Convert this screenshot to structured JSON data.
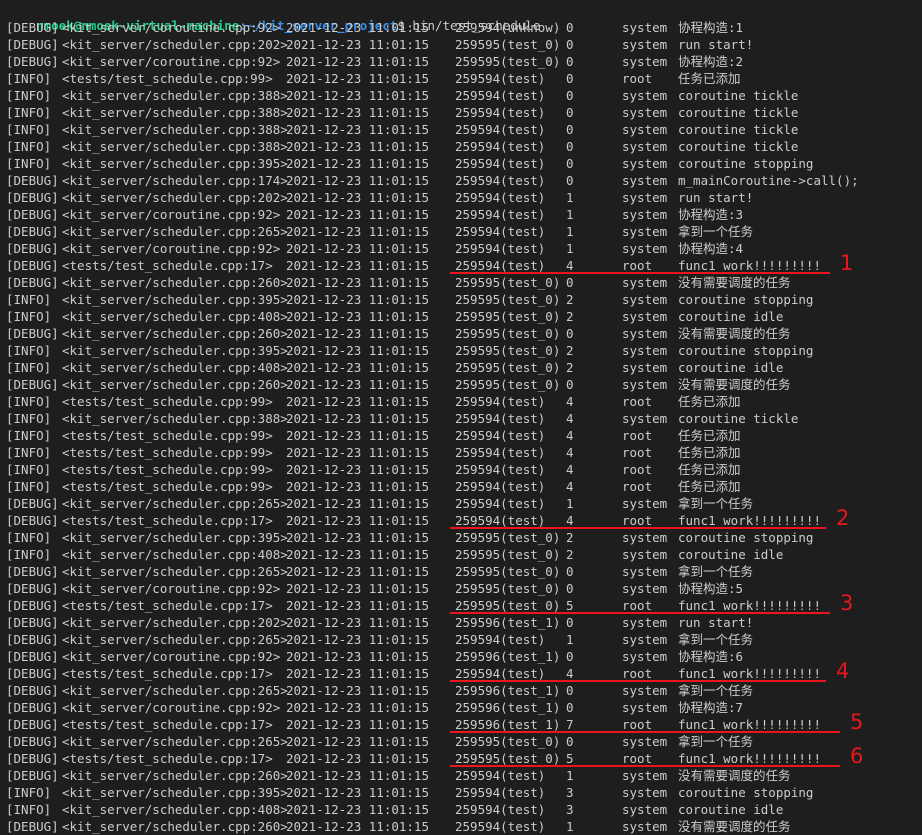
{
  "prompt": {
    "user_host": "nmoek@nmoek-virtual-machine",
    "path": ":~/kit_server_project",
    "command": "$ bin/test_schedule"
  },
  "colors": {
    "background": "#1e1e1e",
    "text": "#cccccc",
    "prompt_user": "#23d18b",
    "prompt_path": "#3b8eea",
    "annotation": "#e8171e"
  },
  "rows": [
    {
      "level": "[DEBUG]",
      "src": "<kit_server/coroutine.cpp:92>",
      "time": "2021-12-23 11:01:15",
      "tid": "259594(unknow)",
      "fib": "0",
      "logger": "system",
      "msg": "协程构造:1"
    },
    {
      "level": "[DEBUG]",
      "src": "<kit_server/scheduler.cpp:202>",
      "time": "2021-12-23 11:01:15",
      "tid": "259595(test_0)",
      "fib": "0",
      "logger": "system",
      "msg": "run start!"
    },
    {
      "level": "[DEBUG]",
      "src": "<kit_server/coroutine.cpp:92>",
      "time": "2021-12-23 11:01:15",
      "tid": "259595(test_0)",
      "fib": "0",
      "logger": "system",
      "msg": "协程构造:2"
    },
    {
      "level": "[INFO]",
      "src": "<tests/test_schedule.cpp:99>",
      "time": "2021-12-23 11:01:15",
      "tid": "259594(test)",
      "fib": "0",
      "logger": "root",
      "msg": "任务已添加"
    },
    {
      "level": "[INFO]",
      "src": "<kit_server/scheduler.cpp:388>",
      "time": "2021-12-23 11:01:15",
      "tid": "259594(test)",
      "fib": "0",
      "logger": "system",
      "msg": "coroutine tickle"
    },
    {
      "level": "[INFO]",
      "src": "<kit_server/scheduler.cpp:388>",
      "time": "2021-12-23 11:01:15",
      "tid": "259594(test)",
      "fib": "0",
      "logger": "system",
      "msg": "coroutine tickle"
    },
    {
      "level": "[INFO]",
      "src": "<kit_server/scheduler.cpp:388>",
      "time": "2021-12-23 11:01:15",
      "tid": "259594(test)",
      "fib": "0",
      "logger": "system",
      "msg": "coroutine tickle"
    },
    {
      "level": "[INFO]",
      "src": "<kit_server/scheduler.cpp:388>",
      "time": "2021-12-23 11:01:15",
      "tid": "259594(test)",
      "fib": "0",
      "logger": "system",
      "msg": "coroutine tickle"
    },
    {
      "level": "[INFO]",
      "src": "<kit_server/scheduler.cpp:395>",
      "time": "2021-12-23 11:01:15",
      "tid": "259594(test)",
      "fib": "0",
      "logger": "system",
      "msg": "coroutine stopping"
    },
    {
      "level": "[DEBUG]",
      "src": "<kit_server/scheduler.cpp:174>",
      "time": "2021-12-23 11:01:15",
      "tid": "259594(test)",
      "fib": "0",
      "logger": "system",
      "msg": "m_mainCoroutine->call();"
    },
    {
      "level": "[DEBUG]",
      "src": "<kit_server/scheduler.cpp:202>",
      "time": "2021-12-23 11:01:15",
      "tid": "259594(test)",
      "fib": "1",
      "logger": "system",
      "msg": "run start!"
    },
    {
      "level": "[DEBUG]",
      "src": "<kit_server/coroutine.cpp:92>",
      "time": "2021-12-23 11:01:15",
      "tid": "259594(test)",
      "fib": "1",
      "logger": "system",
      "msg": "协程构造:3"
    },
    {
      "level": "[DEBUG]",
      "src": "<kit_server/scheduler.cpp:265>",
      "time": "2021-12-23 11:01:15",
      "tid": "259594(test)",
      "fib": "1",
      "logger": "system",
      "msg": "拿到一个任务"
    },
    {
      "level": "[DEBUG]",
      "src": "<kit_server/coroutine.cpp:92>",
      "time": "2021-12-23 11:01:15",
      "tid": "259594(test)",
      "fib": "1",
      "logger": "system",
      "msg": "协程构造:4"
    },
    {
      "level": "[DEBUG]",
      "src": "<tests/test_schedule.cpp:17>",
      "time": "2021-12-23 11:01:15",
      "tid": "259594(test)",
      "fib": "4",
      "logger": "root",
      "msg": "func1 work!!!!!!!!!"
    },
    {
      "level": "[DEBUG]",
      "src": "<kit_server/scheduler.cpp:260>",
      "time": "2021-12-23 11:01:15",
      "tid": "259595(test_0)",
      "fib": "0",
      "logger": "system",
      "msg": "没有需要调度的任务"
    },
    {
      "level": "[INFO]",
      "src": "<kit_server/scheduler.cpp:395>",
      "time": "2021-12-23 11:01:15",
      "tid": "259595(test_0)",
      "fib": "2",
      "logger": "system",
      "msg": "coroutine stopping"
    },
    {
      "level": "[INFO]",
      "src": "<kit_server/scheduler.cpp:408>",
      "time": "2021-12-23 11:01:15",
      "tid": "259595(test_0)",
      "fib": "2",
      "logger": "system",
      "msg": "coroutine idle"
    },
    {
      "level": "[DEBUG]",
      "src": "<kit_server/scheduler.cpp:260>",
      "time": "2021-12-23 11:01:15",
      "tid": "259595(test_0)",
      "fib": "0",
      "logger": "system",
      "msg": "没有需要调度的任务"
    },
    {
      "level": "[INFO]",
      "src": "<kit_server/scheduler.cpp:395>",
      "time": "2021-12-23 11:01:15",
      "tid": "259595(test_0)",
      "fib": "2",
      "logger": "system",
      "msg": "coroutine stopping"
    },
    {
      "level": "[INFO]",
      "src": "<kit_server/scheduler.cpp:408>",
      "time": "2021-12-23 11:01:15",
      "tid": "259595(test_0)",
      "fib": "2",
      "logger": "system",
      "msg": "coroutine idle"
    },
    {
      "level": "[DEBUG]",
      "src": "<kit_server/scheduler.cpp:260>",
      "time": "2021-12-23 11:01:15",
      "tid": "259595(test_0)",
      "fib": "0",
      "logger": "system",
      "msg": "没有需要调度的任务"
    },
    {
      "level": "[INFO]",
      "src": "<tests/test_schedule.cpp:99>",
      "time": "2021-12-23 11:01:15",
      "tid": "259594(test)",
      "fib": "4",
      "logger": "root",
      "msg": "任务已添加"
    },
    {
      "level": "[INFO]",
      "src": "<kit_server/scheduler.cpp:388>",
      "time": "2021-12-23 11:01:15",
      "tid": "259594(test)",
      "fib": "4",
      "logger": "system",
      "msg": "coroutine tickle"
    },
    {
      "level": "[INFO]",
      "src": "<tests/test_schedule.cpp:99>",
      "time": "2021-12-23 11:01:15",
      "tid": "259594(test)",
      "fib": "4",
      "logger": "root",
      "msg": "任务已添加"
    },
    {
      "level": "[INFO]",
      "src": "<tests/test_schedule.cpp:99>",
      "time": "2021-12-23 11:01:15",
      "tid": "259594(test)",
      "fib": "4",
      "logger": "root",
      "msg": "任务已添加"
    },
    {
      "level": "[INFO]",
      "src": "<tests/test_schedule.cpp:99>",
      "time": "2021-12-23 11:01:15",
      "tid": "259594(test)",
      "fib": "4",
      "logger": "root",
      "msg": "任务已添加"
    },
    {
      "level": "[INFO]",
      "src": "<tests/test_schedule.cpp:99>",
      "time": "2021-12-23 11:01:15",
      "tid": "259594(test)",
      "fib": "4",
      "logger": "root",
      "msg": "任务已添加"
    },
    {
      "level": "[DEBUG]",
      "src": "<kit_server/scheduler.cpp:265>",
      "time": "2021-12-23 11:01:15",
      "tid": "259594(test)",
      "fib": "1",
      "logger": "system",
      "msg": "拿到一个任务"
    },
    {
      "level": "[DEBUG]",
      "src": "<tests/test_schedule.cpp:17>",
      "time": "2021-12-23 11:01:15",
      "tid": "259594(test)",
      "fib": "4",
      "logger": "root",
      "msg": "func1 work!!!!!!!!!"
    },
    {
      "level": "[INFO]",
      "src": "<kit_server/scheduler.cpp:395>",
      "time": "2021-12-23 11:01:15",
      "tid": "259595(test_0)",
      "fib": "2",
      "logger": "system",
      "msg": "coroutine stopping"
    },
    {
      "level": "[INFO]",
      "src": "<kit_server/scheduler.cpp:408>",
      "time": "2021-12-23 11:01:15",
      "tid": "259595(test_0)",
      "fib": "2",
      "logger": "system",
      "msg": "coroutine idle"
    },
    {
      "level": "[DEBUG]",
      "src": "<kit_server/scheduler.cpp:265>",
      "time": "2021-12-23 11:01:15",
      "tid": "259595(test_0)",
      "fib": "0",
      "logger": "system",
      "msg": "拿到一个任务"
    },
    {
      "level": "[DEBUG]",
      "src": "<kit_server/coroutine.cpp:92>",
      "time": "2021-12-23 11:01:15",
      "tid": "259595(test_0)",
      "fib": "0",
      "logger": "system",
      "msg": "协程构造:5"
    },
    {
      "level": "[DEBUG]",
      "src": "<tests/test_schedule.cpp:17>",
      "time": "2021-12-23 11:01:15",
      "tid": "259595(test_0)",
      "fib": "5",
      "logger": "root",
      "msg": "func1 work!!!!!!!!!"
    },
    {
      "level": "[DEBUG]",
      "src": "<kit_server/scheduler.cpp:202>",
      "time": "2021-12-23 11:01:15",
      "tid": "259596(test_1)",
      "fib": "0",
      "logger": "system",
      "msg": "run start!"
    },
    {
      "level": "[DEBUG]",
      "src": "<kit_server/scheduler.cpp:265>",
      "time": "2021-12-23 11:01:15",
      "tid": "259594(test)",
      "fib": "1",
      "logger": "system",
      "msg": "拿到一个任务"
    },
    {
      "level": "[DEBUG]",
      "src": "<kit_server/coroutine.cpp:92>",
      "time": "2021-12-23 11:01:15",
      "tid": "259596(test_1)",
      "fib": "0",
      "logger": "system",
      "msg": "协程构造:6"
    },
    {
      "level": "[DEBUG]",
      "src": "<tests/test_schedule.cpp:17>",
      "time": "2021-12-23 11:01:15",
      "tid": "259594(test)",
      "fib": "4",
      "logger": "root",
      "msg": "func1 work!!!!!!!!!"
    },
    {
      "level": "[DEBUG]",
      "src": "<kit_server/scheduler.cpp:265>",
      "time": "2021-12-23 11:01:15",
      "tid": "259596(test_1)",
      "fib": "0",
      "logger": "system",
      "msg": "拿到一个任务"
    },
    {
      "level": "[DEBUG]",
      "src": "<kit_server/coroutine.cpp:92>",
      "time": "2021-12-23 11:01:15",
      "tid": "259596(test_1)",
      "fib": "0",
      "logger": "system",
      "msg": "协程构造:7"
    },
    {
      "level": "[DEBUG]",
      "src": "<tests/test_schedule.cpp:17>",
      "time": "2021-12-23 11:01:15",
      "tid": "259596(test_1)",
      "fib": "7",
      "logger": "root",
      "msg": "func1 work!!!!!!!!!"
    },
    {
      "level": "[DEBUG]",
      "src": "<kit_server/scheduler.cpp:265>",
      "time": "2021-12-23 11:01:15",
      "tid": "259595(test_0)",
      "fib": "0",
      "logger": "system",
      "msg": "拿到一个任务"
    },
    {
      "level": "[DEBUG]",
      "src": "<tests/test_schedule.cpp:17>",
      "time": "2021-12-23 11:01:15",
      "tid": "259595(test_0)",
      "fib": "5",
      "logger": "root",
      "msg": "func1 work!!!!!!!!!"
    },
    {
      "level": "[DEBUG]",
      "src": "<kit_server/scheduler.cpp:260>",
      "time": "2021-12-23 11:01:15",
      "tid": "259594(test)",
      "fib": "1",
      "logger": "system",
      "msg": "没有需要调度的任务"
    },
    {
      "level": "[INFO]",
      "src": "<kit_server/scheduler.cpp:395>",
      "time": "2021-12-23 11:01:15",
      "tid": "259594(test)",
      "fib": "3",
      "logger": "system",
      "msg": "coroutine stopping"
    },
    {
      "level": "[INFO]",
      "src": "<kit_server/scheduler.cpp:408>",
      "time": "2021-12-23 11:01:15",
      "tid": "259594(test)",
      "fib": "3",
      "logger": "system",
      "msg": "coroutine idle"
    },
    {
      "level": "[DEBUG]",
      "src": "<kit_server/scheduler.cpp:260>",
      "time": "2021-12-23 11:01:15",
      "tid": "259594(test)",
      "fib": "1",
      "logger": "system",
      "msg": "没有需要调度的任务"
    }
  ],
  "annotations": [
    {
      "label": "1",
      "row": 14
    },
    {
      "label": "2",
      "row": 29
    },
    {
      "label": "3",
      "row": 34
    },
    {
      "label": "4",
      "row": 38
    },
    {
      "label": "5",
      "row": 41
    },
    {
      "label": "6",
      "row": 43
    }
  ]
}
